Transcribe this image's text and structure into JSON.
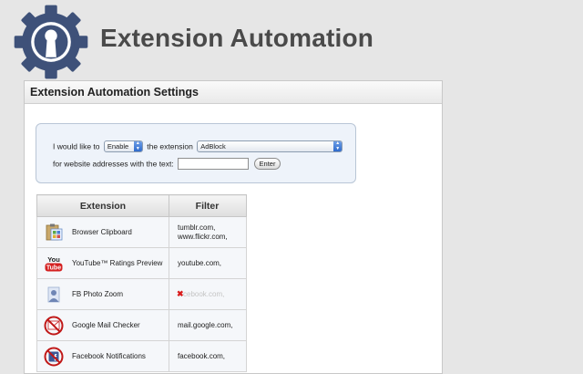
{
  "app": {
    "title": "Extension Automation",
    "logo_icon": "gear-keyhole-icon"
  },
  "panel": {
    "title": "Extension Automation Settings"
  },
  "rule_form": {
    "text_before_action": "I would like to",
    "action_selected": "Enable",
    "text_before_extension": "the extension",
    "extension_selected": "AdBlock",
    "text_website": "for website addresses with the text:",
    "url_value": "",
    "enter_label": "Enter"
  },
  "table": {
    "headers": {
      "extension": "Extension",
      "filter": "Filter"
    },
    "rows": [
      {
        "name": "Browser Clipboard",
        "icon": "clipboard-icon",
        "filter_lines": [
          "tumblr.com,",
          "www.flickr.com,"
        ],
        "filter_struck": false
      },
      {
        "name": "YouTube™ Ratings Preview",
        "icon": "youtube-icon",
        "filter_lines": [
          "youtube.com,"
        ],
        "filter_struck": false
      },
      {
        "name": "FB Photo Zoom",
        "icon": "photo-zoom-icon",
        "filter_lines": [
          "cebook.com,"
        ],
        "filter_struck": true
      },
      {
        "name": "Google Mail Checker",
        "icon": "gmail-disabled-icon",
        "filter_lines": [
          "mail.google.com,"
        ],
        "filter_struck": false
      },
      {
        "name": "Facebook Notifications",
        "icon": "facebook-disabled-icon",
        "filter_lines": [
          "facebook.com,"
        ],
        "filter_struck": false
      }
    ]
  },
  "colors": {
    "title_text": "#4a4a4a",
    "logo_gear": "#3e5179",
    "form_bg": "#eef3fa",
    "select_arrow": "#2f6bcc",
    "disabled_red": "#d81b1b"
  }
}
